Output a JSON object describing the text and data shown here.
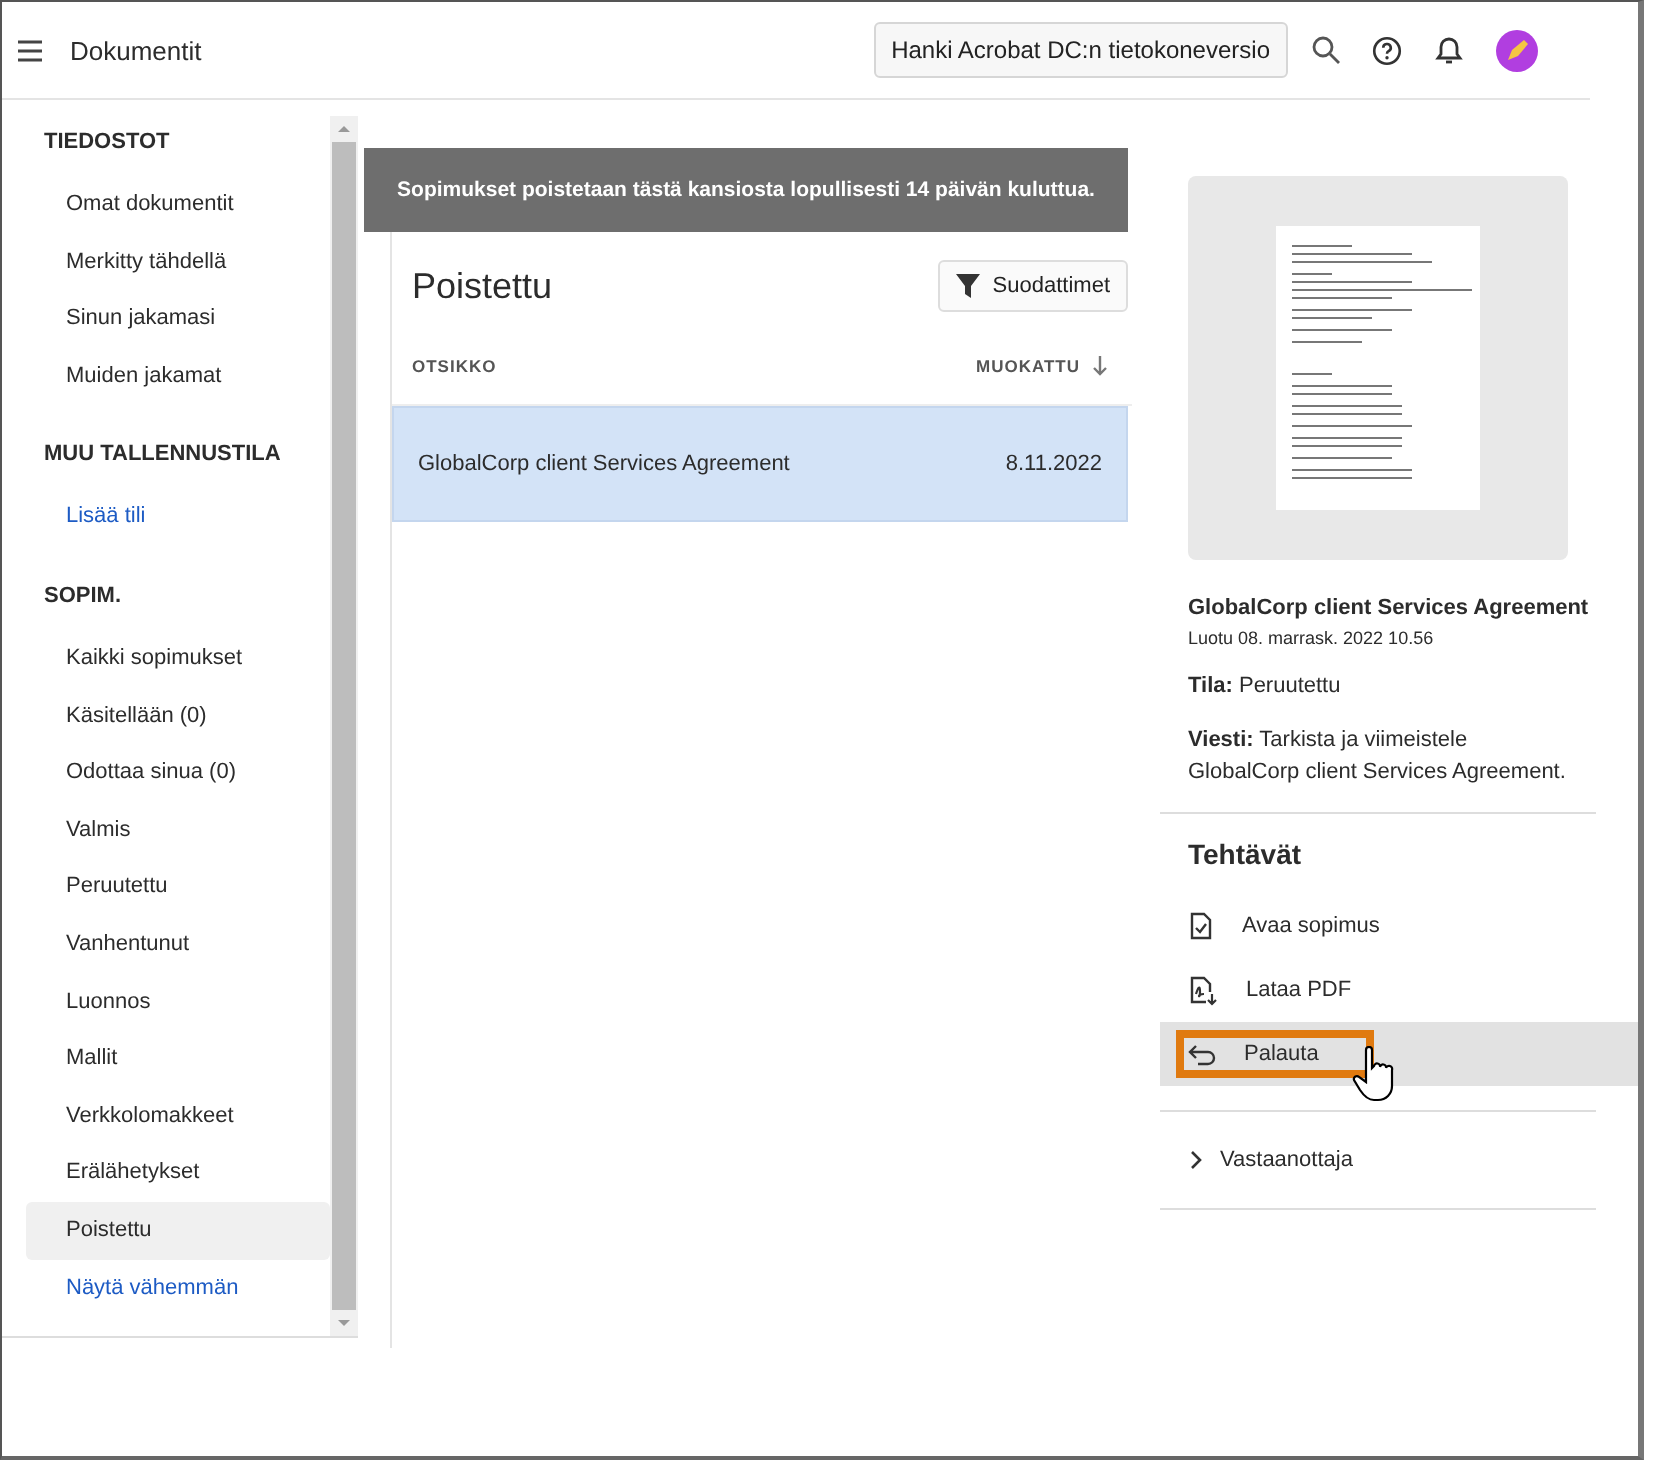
{
  "header": {
    "title": "Dokumentit",
    "get_app_button": "Hanki Acrobat DC:n tietokoneversio"
  },
  "sidebar": {
    "sections": [
      {
        "heading": "TIEDOSTOT",
        "items": [
          {
            "label": "Omat dokumentit",
            "kind": "item",
            "selected": false
          },
          {
            "label": "Merkitty tähdellä",
            "kind": "item",
            "selected": false
          },
          {
            "label": "Sinun jakamasi",
            "kind": "item",
            "selected": false
          },
          {
            "label": "Muiden jakamat",
            "kind": "item",
            "selected": false
          }
        ]
      },
      {
        "heading": "MUU TALLENNUSTILA",
        "items": [
          {
            "label": "Lisää tili",
            "kind": "link",
            "selected": false
          }
        ]
      },
      {
        "heading": "SOPIM.",
        "items": [
          {
            "label": "Kaikki sopimukset",
            "kind": "item",
            "selected": false
          },
          {
            "label": "Käsitellään (0)",
            "kind": "item",
            "selected": false
          },
          {
            "label": "Odottaa sinua (0)",
            "kind": "item",
            "selected": false
          },
          {
            "label": "Valmis",
            "kind": "item",
            "selected": false
          },
          {
            "label": "Peruutettu",
            "kind": "item",
            "selected": false
          },
          {
            "label": "Vanhentunut",
            "kind": "item",
            "selected": false
          },
          {
            "label": "Luonnos",
            "kind": "item",
            "selected": false
          },
          {
            "label": "Mallit",
            "kind": "item",
            "selected": false
          },
          {
            "label": "Verkkolomakkeet",
            "kind": "item",
            "selected": false
          },
          {
            "label": "Erälähetykset",
            "kind": "item",
            "selected": false
          },
          {
            "label": "Poistettu",
            "kind": "item",
            "selected": true
          },
          {
            "label": "Näytä vähemmän",
            "kind": "link",
            "selected": false
          }
        ]
      }
    ]
  },
  "main": {
    "banner": "Sopimukset poistetaan tästä kansiosta lopullisesti 14 päivän kuluttua.",
    "title": "Poistettu",
    "filter_button": "Suodattimet",
    "table": {
      "columns": [
        "OTSIKKO",
        "MUOKATTU"
      ],
      "rows": [
        {
          "title": "GlobalCorp client Services Agreement",
          "modified": "8.11.2022",
          "selected": true
        }
      ]
    }
  },
  "details": {
    "name": "GlobalCorp client Services Agreement",
    "created": "Luotu 08. marrask. 2022 10.56",
    "fields": [
      {
        "label": "Tila:",
        "value": "Peruutettu"
      },
      {
        "label": "Viesti:",
        "value": "Tarkista ja viimeistele GlobalCorp client Services Agreement."
      }
    ],
    "tasks_title": "Tehtävät",
    "tasks": [
      {
        "label": "Avaa sopimus",
        "kind": "open",
        "highlighted": false
      },
      {
        "label": "Lataa PDF",
        "kind": "download",
        "highlighted": false
      },
      {
        "label": "Palauta",
        "kind": "restore",
        "highlighted": true
      }
    ],
    "recipients": {
      "label": "Vastaanottaja",
      "expanded": false
    }
  }
}
